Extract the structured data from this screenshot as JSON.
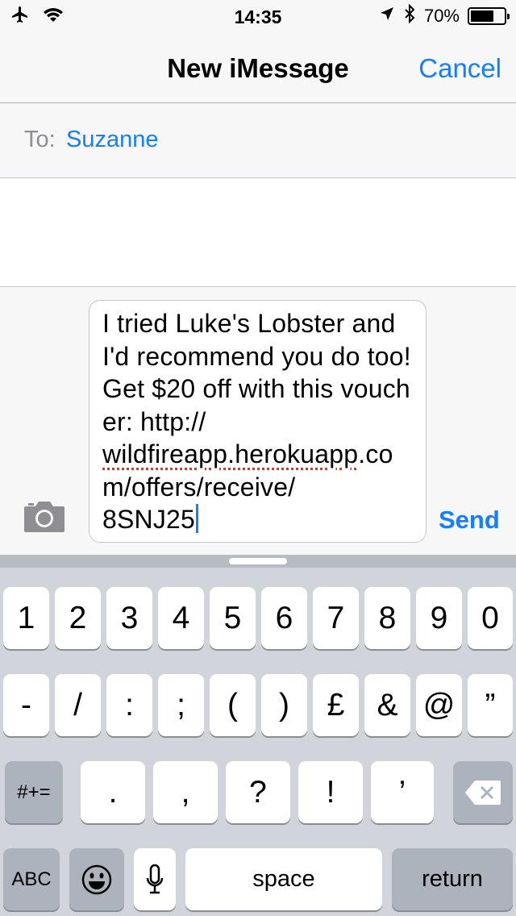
{
  "status_bar": {
    "time": "14:35",
    "battery_text": "70%",
    "battery_level": 0.7,
    "icons": [
      "airplane-icon",
      "wifi-icon",
      "location-arrow-icon",
      "bluetooth-icon",
      "battery-icon"
    ]
  },
  "nav": {
    "title": "New iMessage",
    "cancel_label": "Cancel"
  },
  "recipient": {
    "to_label": "To:",
    "name": "Suzanne"
  },
  "composer": {
    "message_before": "I tried Luke's Lobster and I'd recommend you do too! Get $20 off with this voucher: http://\n",
    "message_misspelled": "wildfireapp.herokuapp",
    "message_after": ".com/offers/receive/\n8SNJ25",
    "send_label": "Send",
    "camera_icon": "camera-icon"
  },
  "keyboard": {
    "row1": [
      "1",
      "2",
      "3",
      "4",
      "5",
      "6",
      "7",
      "8",
      "9",
      "0"
    ],
    "row2": [
      "-",
      "/",
      ":",
      ";",
      "(",
      ")",
      "£",
      "&",
      "@",
      "”"
    ],
    "row3": {
      "shift_label": "#+=",
      "keys": [
        ".",
        ",",
        "?",
        "!",
        "’"
      ],
      "delete_icon": "backspace-icon"
    },
    "row4": {
      "abc_label": "ABC",
      "emoji_icon": "emoji-icon",
      "mic_icon": "microphone-icon",
      "space_label": "space",
      "return_label": "return"
    }
  },
  "colors": {
    "accent": "#147efb",
    "keyboard_bg": "#d1d5db",
    "dark_key": "#adb3bc"
  }
}
